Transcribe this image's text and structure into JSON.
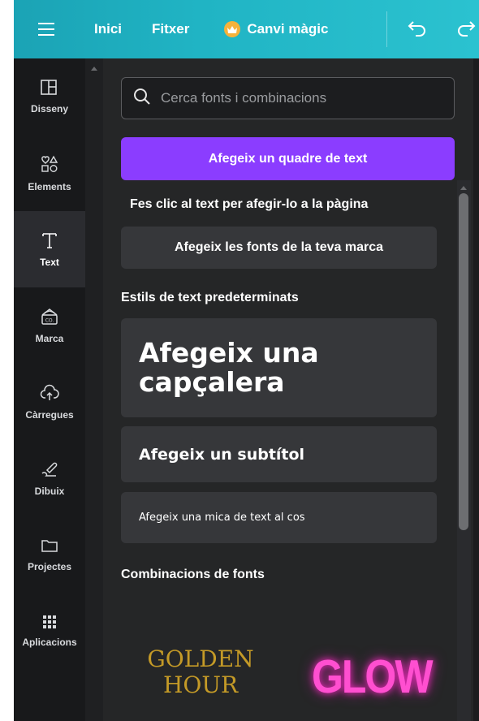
{
  "topbar": {
    "menu_icon": "hamburger-icon",
    "home": "Inici",
    "file": "Fitxer",
    "magic": "Canvi màgic",
    "undo_icon": "undo-icon",
    "redo_icon": "redo-icon",
    "gradient_start": "#1ba3b5",
    "gradient_end": "#2bc2d0"
  },
  "rail": {
    "items": [
      {
        "label": "Disseny",
        "icon": "layout-icon"
      },
      {
        "label": "Elements",
        "icon": "shapes-icon"
      },
      {
        "label": "Text",
        "icon": "text-icon",
        "active": true
      },
      {
        "label": "Marca",
        "icon": "brand-icon"
      },
      {
        "label": "Càrregues",
        "icon": "upload-cloud-icon"
      },
      {
        "label": "Dibuix",
        "icon": "draw-icon"
      },
      {
        "label": "Projectes",
        "icon": "folder-icon"
      },
      {
        "label": "Aplicacions",
        "icon": "apps-grid-icon"
      }
    ]
  },
  "panel": {
    "search_placeholder": "Cerca fonts i combinacions",
    "add_textbox": "Afegeix un quadre de text",
    "hint": "Fes clic al text per afegir-lo a la pàgina",
    "brand_fonts": "Afegeix les fonts de la teva marca",
    "default_styles_title": "Estils de text predeterminats",
    "heading": "Afegeix una capçalera",
    "subtitle": "Afegeix un subtítol",
    "body": "Afegeix una mica de text al cos",
    "combos_title": "Combinacions de fonts",
    "combo_1": "GOLDEN HOUR",
    "combo_2": "GLOW",
    "accent": "#8b3dff"
  }
}
